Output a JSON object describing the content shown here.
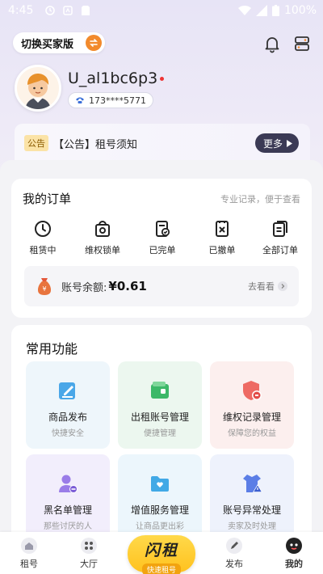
{
  "status_bar": {
    "time": "4:45",
    "battery": "100%"
  },
  "header": {
    "switch_label": "切换买家版"
  },
  "profile": {
    "username": "U_al1bc6p3",
    "phone": "173****5771"
  },
  "notice": {
    "tag": "公告",
    "text": "【公告】租号须知",
    "more_label": "更多"
  },
  "orders": {
    "title": "我的订单",
    "subtitle": "专业记录，便于查看",
    "items": [
      {
        "label": "租赁中",
        "icon": "clock-icon"
      },
      {
        "label": "维权锁单",
        "icon": "lock-bag-icon"
      },
      {
        "label": "已完单",
        "icon": "check-doc-icon"
      },
      {
        "label": "已撤单",
        "icon": "cancel-doc-icon"
      },
      {
        "label": "全部订单",
        "icon": "list-doc-icon"
      }
    ],
    "balance_label": "账号余额:",
    "balance_value": "¥0.61",
    "balance_link": "去看看"
  },
  "functions": {
    "title": "常用功能",
    "tiles": [
      {
        "title": "商品发布",
        "subtitle": "快捷安全",
        "icon": "edit-doc-icon"
      },
      {
        "title": "出租账号管理",
        "subtitle": "便捷管理",
        "icon": "wallet-icon"
      },
      {
        "title": "维权记录管理",
        "subtitle": "保障您的权益",
        "icon": "shield-icon"
      },
      {
        "title": "黑名单管理",
        "subtitle": "那些讨厌的人",
        "icon": "block-user-icon"
      },
      {
        "title": "增值服务管理",
        "subtitle": "让商品更出彩",
        "icon": "folder-heart-icon"
      },
      {
        "title": "账号异常处理",
        "subtitle": "卖家及时处理",
        "icon": "alert-shirt-icon"
      }
    ]
  },
  "tabbar": {
    "items": [
      {
        "label": "租号"
      },
      {
        "label": "大厅"
      },
      {
        "label": "发布"
      },
      {
        "label": "我的"
      }
    ],
    "center_big": "闪租",
    "center_small": "快速租号"
  },
  "colors": {
    "accent_orange": "#f28a2c",
    "center_yellow": "#ffc21f",
    "more_button": "#3b3a55"
  }
}
